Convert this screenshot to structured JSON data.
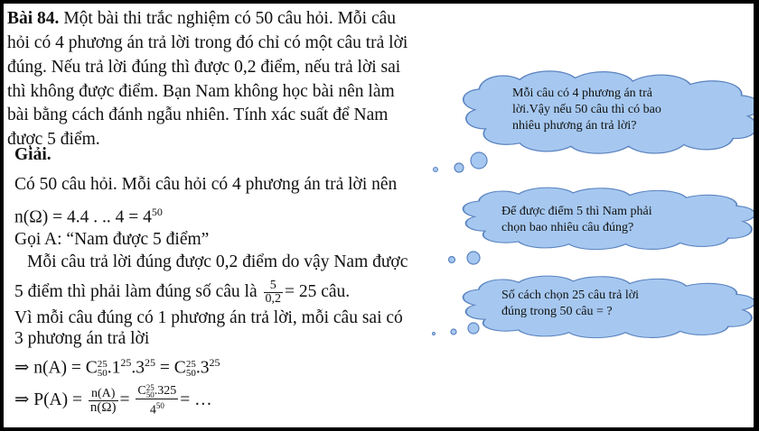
{
  "problem": {
    "title": "Bài 84.",
    "lines": [
      "Một bài thi trắc nghiệm có 50 câu hỏi. Mỗi câu",
      "hỏi có 4 phương án trả lời trong đó chỉ có một câu trả lời",
      "đúng. Nếu trả lời đúng thì được 0,2 điểm, nếu trả lời sai",
      "thì không được điểm. Bạn Nam không học bài nên làm",
      "bài bằng cách đánh ngẫu nhiên. Tính xác suất để Nam",
      "được 5 điểm."
    ]
  },
  "solution": {
    "heading": "Giải.",
    "line1": "Có 50 câu hỏi. Mỗi câu hỏi có 4 phương án trả lời nên",
    "line2_prefix": "n(Ω) = 4.4 . .. 4 = 4",
    "line2_exp": "50",
    "line3": "Gọi A: “Nam được 5 điểm”",
    "line4": "Mỗi câu trả lời đúng được 0,2 điểm do vậy Nam được",
    "line5_prefix": "5 điểm thì phải làm đúng số câu là",
    "line5_num": "5",
    "line5_den": "0,2",
    "line5_suffix": "= 25 câu.",
    "line6": "Vì mỗi câu đúng có 1 phương án trả lời, mỗi câu sai có",
    "line7": "3 phương án trả lời",
    "line8_arrow": "⇒",
    "line8_a": "n(A) = C",
    "line8_sup1": "25",
    "line8_sub1": "50",
    "line8_b": ".1",
    "line8_exp1": "25",
    "line8_c": ".3",
    "line8_exp2": "25",
    "line8_d": " = C",
    "line8_sup2": "25",
    "line8_sub2": "50",
    "line8_e": ".3",
    "line8_exp3": "25",
    "line9_arrow": "⇒",
    "line9_a": "P(A) =",
    "line9_f1_num": "n(A)",
    "line9_f1_den": "n(Ω)",
    "line9_eq": "=",
    "line9_f2_num_c": "C",
    "line9_f2_num_sup": "25",
    "line9_f2_num_sub": "50",
    "line9_f2_num_rest": ".325",
    "line9_f2_den_base": "4",
    "line9_f2_den_exp": "50",
    "line9_end": "= …"
  },
  "clouds": [
    {
      "text_lines": [
        "Mỗi câu có 4 phương án trả",
        "lời.Vậy nếu 50 câu thì có bao",
        "nhiêu phương án trả lời?"
      ]
    },
    {
      "text_lines": [
        "Để được điểm 5 thì Nam phải",
        "chọn bao nhiêu câu đúng?"
      ]
    },
    {
      "text_lines": [
        "Số cách chọn 25 câu trả lời",
        "đúng trong 50 câu = ?"
      ]
    }
  ],
  "colors": {
    "cloud_fill": "#a6c8f0",
    "cloud_stroke": "#5b84c0",
    "frame": "#000000"
  }
}
